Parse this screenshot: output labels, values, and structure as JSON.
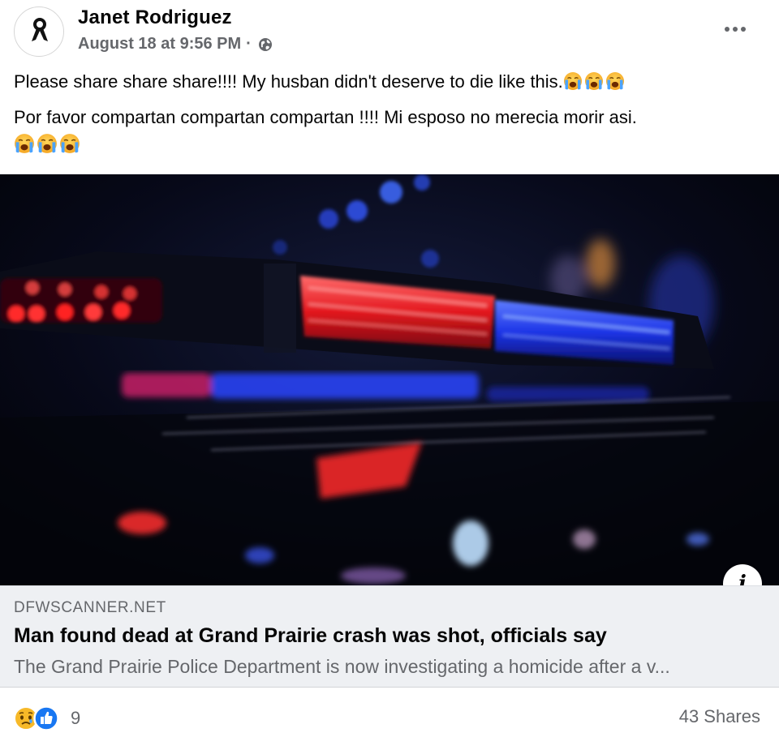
{
  "post": {
    "author": "Janet Rodriguez",
    "timestamp": "August 18 at 9:56 PM",
    "separator": "·",
    "privacy_icon": "globe-icon",
    "more_icon": "more-options-icon",
    "text_en": "Please share share share!!!! My husban didn't deserve to die like this.",
    "text_es": "Por favor compartan compartan compartan !!!! Mi esposo no merecia morir asi.",
    "emoji": "loudly-crying-face"
  },
  "link_preview": {
    "domain": "DFWSCANNER.NET",
    "headline": "Man found dead at Grand Prairie crash was shot, officials say",
    "description": "The Grand Prairie Police Department is now investigating a homicide after a v...",
    "info_label": "i",
    "image_subject": "police-lights-image"
  },
  "footer": {
    "reaction_icons": [
      "sad-reaction-icon",
      "like-reaction-icon"
    ],
    "reaction_count": "9",
    "shares": "43 Shares"
  },
  "colors": {
    "text_primary": "#050505",
    "text_secondary": "#65676b",
    "card_bg": "#eef0f3",
    "like_blue": "#1877f2",
    "reaction_yellow": "#f7b928"
  }
}
